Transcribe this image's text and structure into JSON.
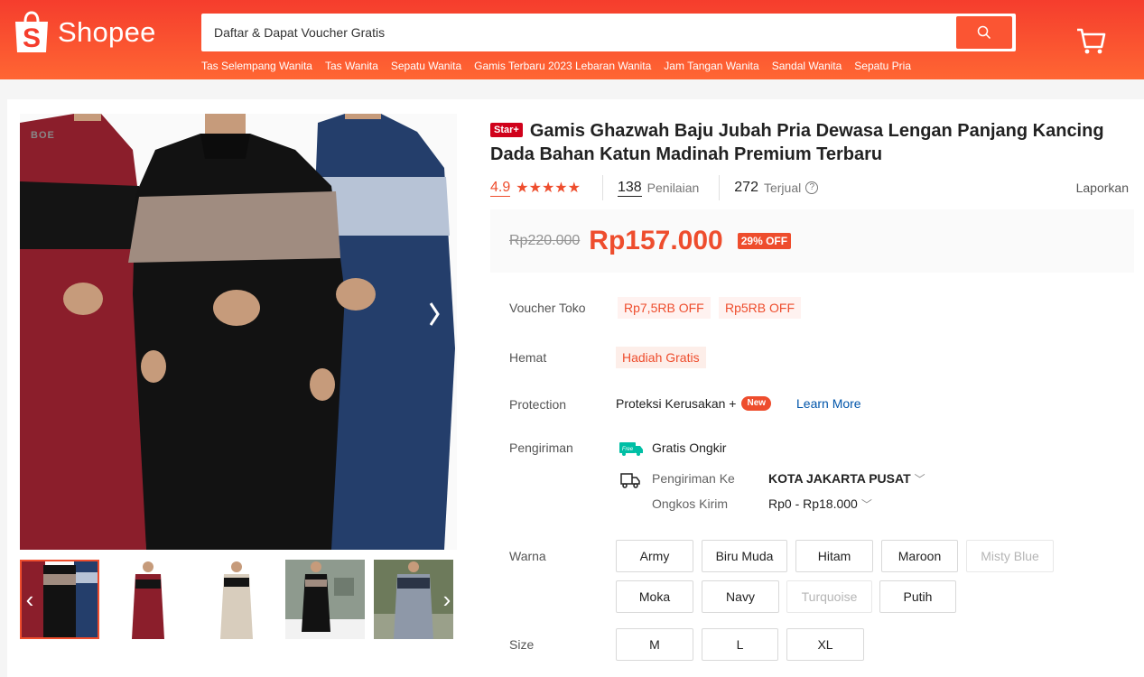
{
  "header": {
    "logo_text": "Shopee",
    "search_placeholder": "Daftar & Dapat Voucher Gratis",
    "suggestions": [
      "Tas Selempang Wanita",
      "Tas Wanita",
      "Sepatu Wanita",
      "Gamis Terbaru 2023 Lebaran Wanita",
      "Jam Tangan Wanita",
      "Sandal Wanita",
      "Sepatu Pria"
    ]
  },
  "gallery": {
    "brand_mark": "BOE",
    "thumb_count": 5,
    "active_thumb": 0
  },
  "product": {
    "badge": "Star+",
    "title": "Gamis Ghazwah Baju Jubah Pria Dewasa Lengan Panjang Kancing Dada Bahan Katun Madinah Premium Terbaru",
    "rating": "4.9",
    "stars": "★★★★★",
    "reviews_count": "138",
    "reviews_label": "Penilaian",
    "sold_count": "272",
    "sold_label": "Terjual",
    "report_label": "Laporkan",
    "price_old": "Rp220.000",
    "price_new": "Rp157.000",
    "discount": "29% OFF"
  },
  "details": {
    "voucher_label": "Voucher Toko",
    "vouchers": [
      "Rp7,5RB OFF",
      "Rp5RB OFF"
    ],
    "hemat_label": "Hemat",
    "hemat_value": "Hadiah Gratis",
    "protection_label": "Protection",
    "protection_value": "Proteksi Kerusakan +",
    "protection_badge": "New",
    "learn_more": "Learn More",
    "shipping_label": "Pengiriman",
    "free_ship_icon_text": "Free",
    "free_shipping": "Gratis Ongkir",
    "ship_to_label": "Pengiriman Ke",
    "ship_to_value": "KOTA JAKARTA PUSAT",
    "ongkos_label": "Ongkos Kirim",
    "ongkos_value": "Rp0 - Rp18.000"
  },
  "variants": {
    "color_label": "Warna",
    "colors": [
      {
        "name": "Army",
        "available": true
      },
      {
        "name": "Biru Muda",
        "available": true
      },
      {
        "name": "Hitam",
        "available": true
      },
      {
        "name": "Maroon",
        "available": true
      },
      {
        "name": "Misty Blue",
        "available": false
      },
      {
        "name": "Moka",
        "available": true
      },
      {
        "name": "Navy",
        "available": true
      },
      {
        "name": "Turquoise",
        "available": false
      },
      {
        "name": "Putih",
        "available": true
      }
    ],
    "size_label": "Size",
    "sizes": [
      "M",
      "L",
      "XL"
    ]
  },
  "colors": {
    "brand": "#ee4d2d",
    "maroon": "#8b1e2b",
    "navy": "#243e6b",
    "black": "#121212",
    "moka": "#a08c80",
    "light_blue": "#b7c3d6"
  }
}
